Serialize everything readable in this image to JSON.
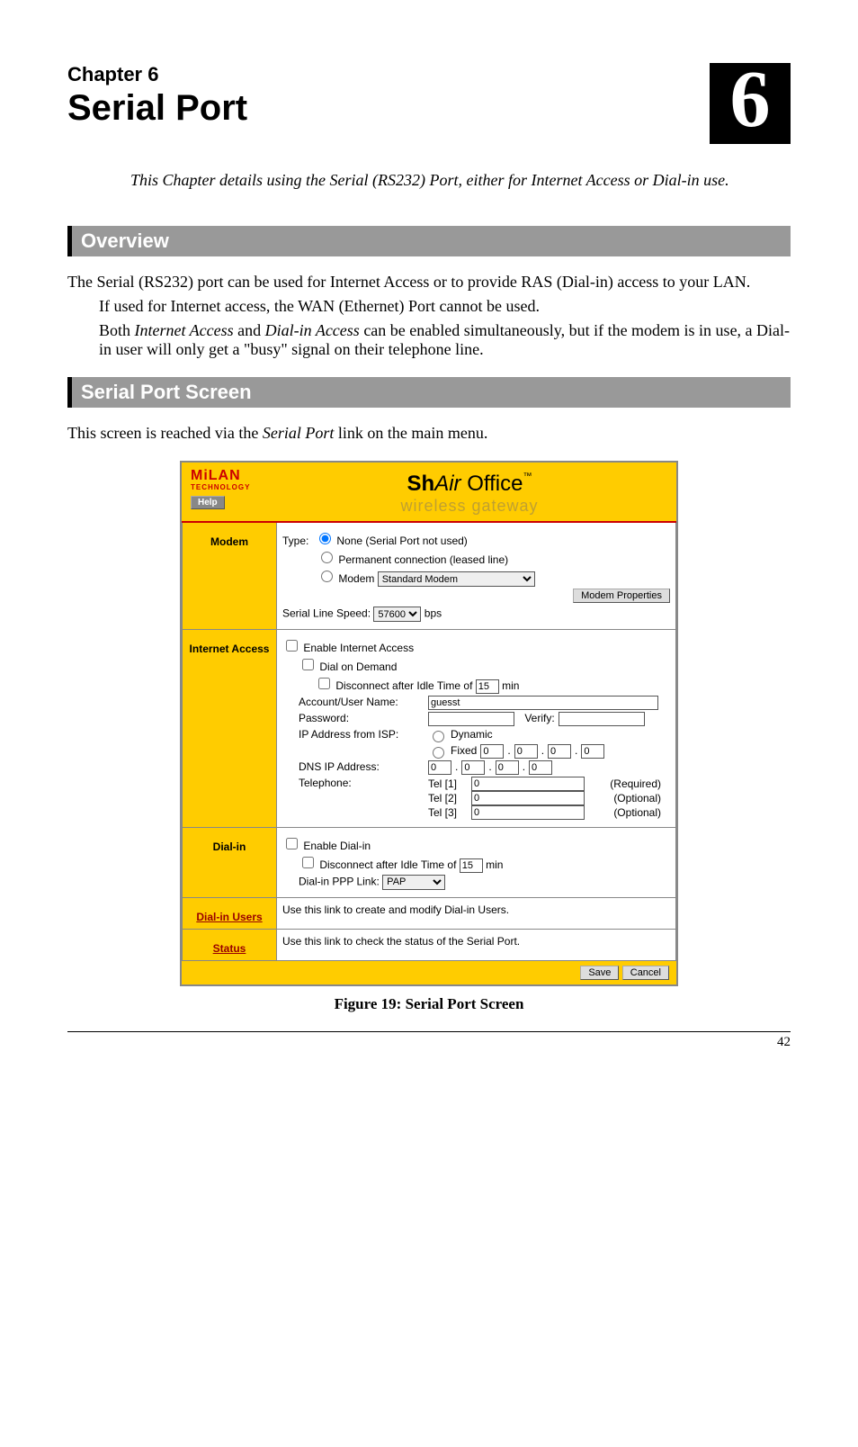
{
  "chapter": {
    "label": "Chapter 6",
    "title": "Serial Port",
    "badge": "6"
  },
  "intro": "This Chapter details using the Serial (RS232) Port, either for Internet Access or Dial-in use.",
  "sections": {
    "overview": {
      "heading": "Overview",
      "p1": "The Serial (RS232) port can be used for Internet Access or to provide RAS (Dial-in) access to your LAN.",
      "p2": "If used for Internet access, the WAN (Ethernet) Port cannot be used.",
      "p3_a": "Both ",
      "p3_em1": "Internet Access",
      "p3_b": " and ",
      "p3_em2": "Dial-in Access",
      "p3_c": " can be enabled simultaneously, but if the modem is in use, a Dial-in user will only get a \"busy\" signal on their telephone line."
    },
    "serial_screen": {
      "heading": "Serial Port Screen",
      "lead_a": "This screen is reached via the ",
      "lead_em": "Serial Port",
      "lead_b": " link on the main menu."
    }
  },
  "screenshot": {
    "brand_line1": "MiLAN",
    "brand_line2": "TECHNOLOGY",
    "help": "Help",
    "title_bold": "Sh",
    "title_ital": "Air",
    "title_rest": " Office",
    "title_tm": "™",
    "subtitle": "wireless gateway",
    "modem": {
      "label": "Modem",
      "type_label": "Type:",
      "opt_none": "None (Serial Port not used)",
      "opt_perm": "Permanent connection (leased line)",
      "opt_modem": "Modem",
      "modem_select": "Standard Modem",
      "modem_props": "Modem Properties",
      "serial_speed_label": "Serial Line Speed:",
      "serial_speed_value": "57600",
      "bps": "bps"
    },
    "internet": {
      "label": "Internet Access",
      "enable": "Enable Internet Access",
      "dial_demand": "Dial on Demand",
      "disconnect_a": "Disconnect after Idle Time of",
      "disconnect_val": "15",
      "disconnect_b": "min",
      "account_label": "Account/User Name:",
      "account_val": "guesst",
      "password_label": "Password:",
      "verify_label": "Verify:",
      "ip_from_isp": "IP Address from ISP:",
      "dynamic": "Dynamic",
      "fixed": "Fixed",
      "ip1": "0",
      "ip2": "0",
      "ip3": "0",
      "ip4": "0",
      "dns_label": "DNS IP Address:",
      "dns1": "0",
      "dns2": "0",
      "dns3": "0",
      "dns4": "0",
      "tel_label": "Telephone:",
      "tel1_lbl": "Tel [1]",
      "tel1_val": "0",
      "tel1_note": "(Required)",
      "tel2_lbl": "Tel [2]",
      "tel2_val": "0",
      "tel2_note": "(Optional)",
      "tel3_lbl": "Tel [3]",
      "tel3_val": "0",
      "tel3_note": "(Optional)"
    },
    "dialin": {
      "label": "Dial-in",
      "enable": "Enable Dial-in",
      "disconnect_a": "Disconnect after Idle Time of",
      "disconnect_val": "15",
      "disconnect_b": "min",
      "ppp_label": "Dial-in PPP Link:",
      "ppp_val": "PAP"
    },
    "dialin_users": {
      "label": "Dial-in Users",
      "text": "Use this link to create and modify Dial-in Users."
    },
    "status": {
      "label": "Status",
      "text": "Use this link to check the status of the Serial Port."
    },
    "footer": {
      "save": "Save",
      "cancel": "Cancel"
    }
  },
  "caption": "Figure 19: Serial Port Screen",
  "page_number": "42"
}
